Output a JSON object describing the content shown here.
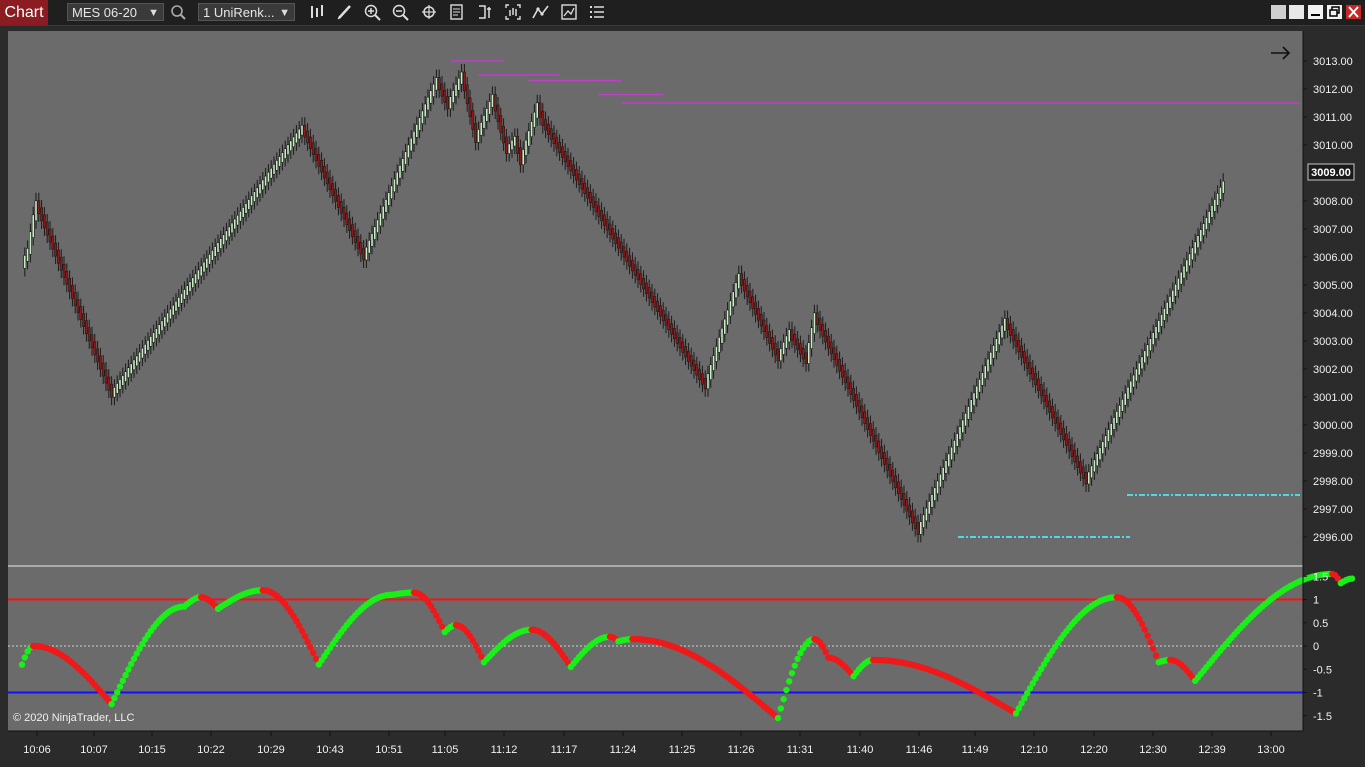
{
  "toolbar": {
    "tab_label": "Chart",
    "instrument": "MES 06-20",
    "bar_type": "1 UniRenk...",
    "icons": [
      "search-icon",
      "bar-style-icon",
      "draw-pencil-icon",
      "zoom-in-icon",
      "zoom-out-icon",
      "crosshair-icon",
      "data-box-icon",
      "strategy-icon",
      "chart-trader-icon",
      "indicators-icon",
      "properties-icon",
      "list-icon"
    ],
    "window_icons": [
      "restore-icon",
      "tile-icon",
      "minimize-icon",
      "maximize-icon",
      "close-icon"
    ]
  },
  "chart": {
    "copyright": "© 2020 NinjaTrader, LLC",
    "last_price_label": "3009.00",
    "colors": {
      "background": "#6b6b6b",
      "up_candle": "#c8ecc4",
      "down_candle": "#8b1a1a",
      "resistance": "#c040c8",
      "support": "#4dd8e8",
      "osc_up": "#18f018",
      "osc_down": "#f01818",
      "upper_line": "#ff1010",
      "lower_line": "#1010ff"
    },
    "price_axis": [
      "3013.00",
      "3012.00",
      "3011.00",
      "3010.00",
      "3008.00",
      "3007.00",
      "3006.00",
      "3005.00",
      "3004.00",
      "3003.00",
      "3002.00",
      "3001.00",
      "3000.00",
      "2999.00",
      "2998.00",
      "2997.00",
      "2996.00"
    ],
    "osc_axis": [
      "1.5",
      "1",
      "0.5",
      "0",
      "-0.5",
      "-1",
      "-1.5"
    ],
    "time_axis": [
      "10:06",
      "10:07",
      "10:15",
      "10:22",
      "10:29",
      "10:43",
      "10:51",
      "11:05",
      "11:12",
      "11:17",
      "11:24",
      "11:25",
      "11:26",
      "11:31",
      "11:40",
      "11:46",
      "11:49",
      "12:10",
      "12:20",
      "12:30",
      "12:39",
      "13:00"
    ]
  },
  "chart_data": {
    "type": "candlestick",
    "price_points": [
      [
        0,
        3005.7
      ],
      [
        2,
        3006.2
      ],
      [
        4,
        3007.4
      ],
      [
        5,
        3007.9
      ],
      [
        32,
        3001.1
      ],
      [
        100,
        3010.6
      ],
      [
        122,
        3006.0
      ],
      [
        145,
        3011.6
      ],
      [
        148,
        3012.3
      ],
      [
        152,
        3011.4
      ],
      [
        157,
        3012.5
      ],
      [
        162,
        3010.2
      ],
      [
        168,
        3011.7
      ],
      [
        173,
        3009.8
      ],
      [
        176,
        3010.2
      ],
      [
        178,
        3009.4
      ],
      [
        184,
        3011.4
      ],
      [
        186,
        3010.8
      ],
      [
        244,
        3001.4
      ],
      [
        256,
        3005.3
      ],
      [
        270,
        3002.4
      ],
      [
        274,
        3003.3
      ],
      [
        280,
        3002.3
      ],
      [
        283,
        3003.9
      ],
      [
        320,
        2996.2
      ],
      [
        351,
        3003.7
      ],
      [
        380,
        2998.0
      ],
      [
        429,
        3008.6
      ]
    ],
    "resistance_levels": [
      3013.0,
      3012.5,
      3012.3,
      3011.8,
      3011.5
    ],
    "support_levels": [
      2997.5,
      2996.0
    ],
    "oscillator": {
      "upper_band": 1,
      "lower_band": -1,
      "zero_line": 0,
      "ylim": [
        -1.5,
        1.5
      ],
      "points": [
        [
          0,
          -0.4
        ],
        [
          4,
          0.0
        ],
        [
          32,
          -1.25
        ],
        [
          58,
          0.85
        ],
        [
          64,
          1.05
        ],
        [
          70,
          0.8
        ],
        [
          86,
          1.2
        ],
        [
          106,
          -0.4
        ],
        [
          132,
          1.1
        ],
        [
          140,
          1.15
        ],
        [
          151,
          0.3
        ],
        [
          155,
          0.45
        ],
        [
          165,
          -0.35
        ],
        [
          182,
          0.35
        ],
        [
          196,
          -0.45
        ],
        [
          210,
          0.2
        ],
        [
          213,
          0.1
        ],
        [
          218,
          0.15
        ],
        [
          270,
          -1.55
        ],
        [
          283,
          0.15
        ],
        [
          288,
          -0.25
        ],
        [
          297,
          -0.65
        ],
        [
          304,
          -0.3
        ],
        [
          355,
          -1.45
        ],
        [
          391,
          1.05
        ],
        [
          406,
          -0.35
        ],
        [
          410,
          -0.3
        ],
        [
          419,
          -0.75
        ],
        [
          468,
          1.55
        ],
        [
          471,
          1.35
        ],
        [
          475,
          1.45
        ]
      ]
    }
  }
}
